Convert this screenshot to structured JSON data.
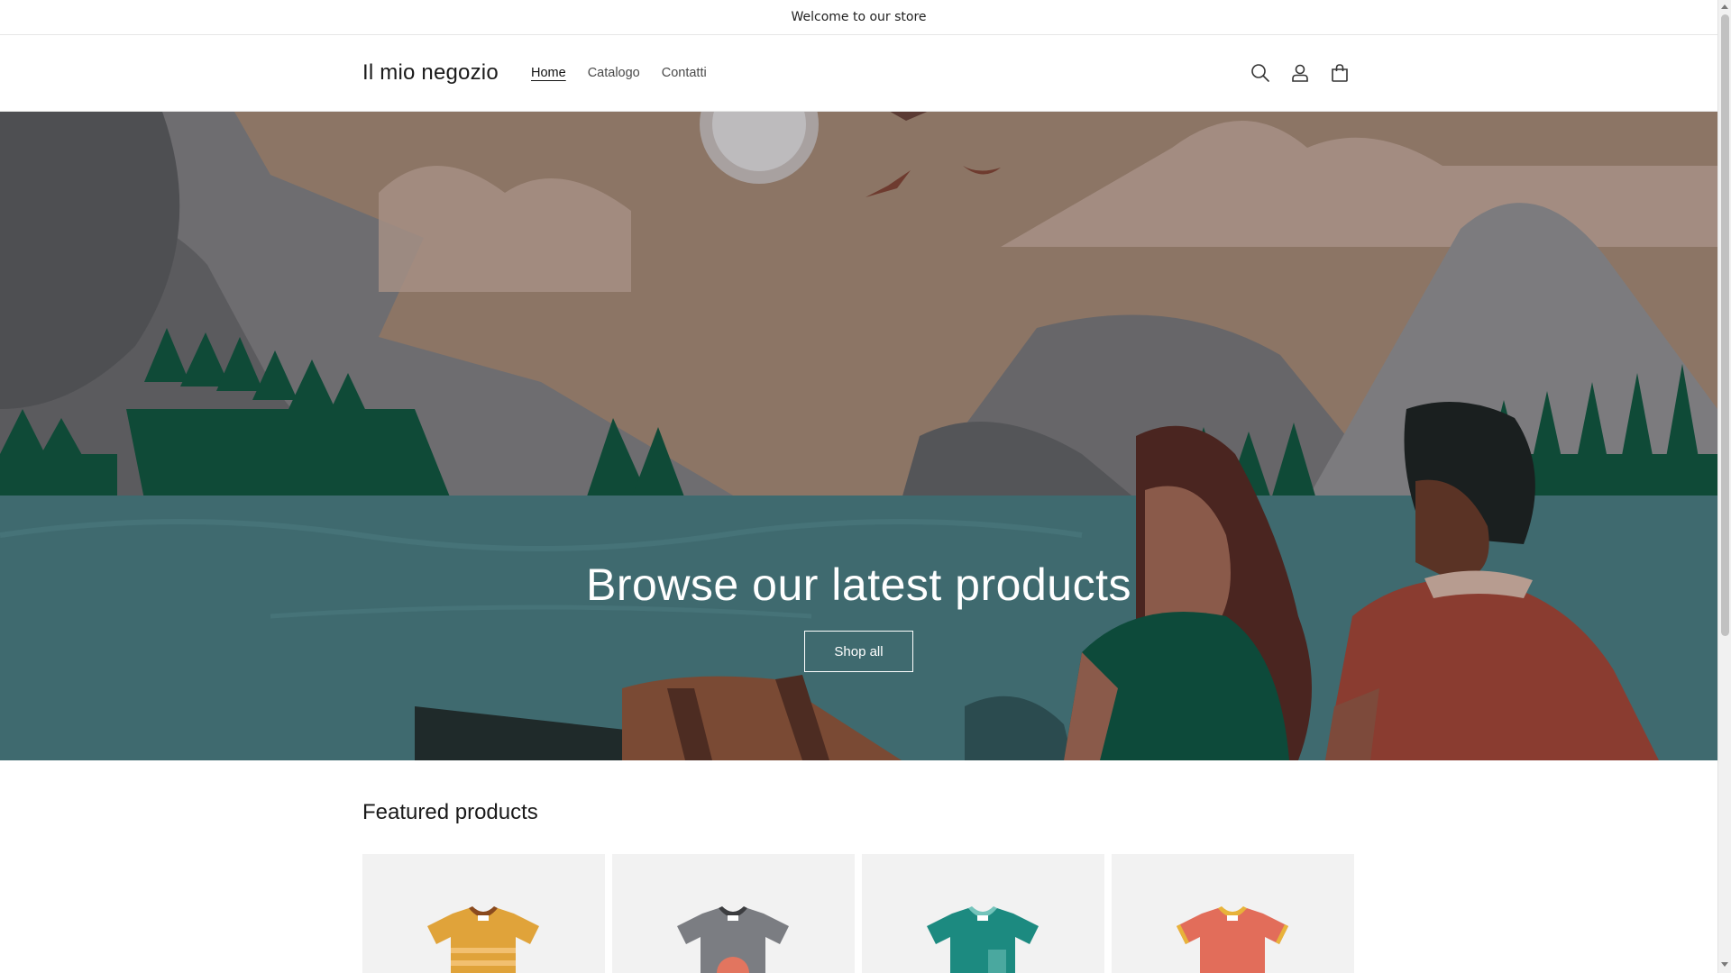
{
  "announcement": {
    "text": "Welcome to our store"
  },
  "header": {
    "logo": "Il mio negozio",
    "nav": [
      {
        "label": "Home",
        "active": true
      },
      {
        "label": "Catalogo",
        "active": false
      },
      {
        "label": "Contatti",
        "active": false
      }
    ],
    "icons": [
      "search-icon",
      "account-icon",
      "cart-icon"
    ]
  },
  "hero": {
    "title": "Browse our latest products",
    "button_label": "Shop all"
  },
  "featured": {
    "title": "Featured products",
    "products": [
      {
        "image": "tshirt-orange-striped"
      },
      {
        "image": "tshirt-gray-sun"
      },
      {
        "image": "tshirt-teal-pocket"
      },
      {
        "image": "tshirt-coral"
      }
    ]
  },
  "colors": {
    "text": "#121212",
    "hero_sky": "#8c7565",
    "hero_water": "#3f6a6f",
    "card_bg": "#f2f2f2"
  }
}
